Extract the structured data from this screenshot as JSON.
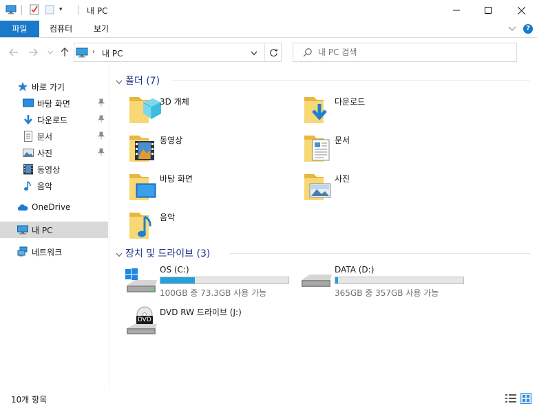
{
  "window": {
    "title": "내 PC",
    "quick_access_dropdown": "▾",
    "minimize_glyph": "—",
    "maximize_glyph": "☐",
    "close_glyph": "✕"
  },
  "ribbon": {
    "tabs": [
      {
        "label": "파일",
        "active": true
      },
      {
        "label": "컴퓨터"
      },
      {
        "label": "보기"
      }
    ],
    "help_glyph": "?"
  },
  "address_bar": {
    "path": "내 PC",
    "separator": "›"
  },
  "search": {
    "placeholder": "내 PC 검색"
  },
  "sidebar": {
    "quick_access": {
      "label": "바로 가기",
      "icon": "star-icon"
    },
    "pinned": [
      {
        "label": "바탕 화면",
        "icon": "desktop-icon",
        "pinned": true
      },
      {
        "label": "다운로드",
        "icon": "download-icon",
        "pinned": true
      },
      {
        "label": "문서",
        "icon": "document-icon",
        "pinned": true
      },
      {
        "label": "사진",
        "icon": "pictures-icon",
        "pinned": true
      },
      {
        "label": "동영상",
        "icon": "video-icon",
        "pinned": false
      },
      {
        "label": "음악",
        "icon": "music-icon",
        "pinned": false
      }
    ],
    "onedrive": {
      "label": "OneDrive",
      "icon": "cloud-icon"
    },
    "this_pc": {
      "label": "내 PC",
      "icon": "pc-icon",
      "selected": true
    },
    "network": {
      "label": "네트워크",
      "icon": "network-icon"
    }
  },
  "folders_group": {
    "label": "폴더 (7)",
    "items": [
      {
        "label": "3D 개체",
        "overlay": "3d-cube-icon"
      },
      {
        "label": "다운로드",
        "overlay": "download-arrow-icon"
      },
      {
        "label": "동영상",
        "overlay": "film-icon"
      },
      {
        "label": "문서",
        "overlay": "document-icon"
      },
      {
        "label": "바탕 화면",
        "overlay": "desktop-icon"
      },
      {
        "label": "사진",
        "overlay": "landscape-icon"
      },
      {
        "label": "음악",
        "overlay": "music-note-icon"
      }
    ]
  },
  "drives_group": {
    "label": "장치 및 드라이브 (3)",
    "items": [
      {
        "name": "OS (C:)",
        "status": "100GB 중 73.3GB 사용 가능",
        "used_fraction": 0.267,
        "icon": "windows-drive-icon",
        "has_bar": true
      },
      {
        "name": "DATA (D:)",
        "status": "365GB 중 357GB 사용 가능",
        "used_fraction": 0.022,
        "icon": "hard-drive-icon",
        "has_bar": true
      },
      {
        "name": "DVD RW 드라이브 (J:)",
        "status": "",
        "icon": "dvd-drive-icon",
        "has_bar": false,
        "disc_label": "DVD"
      }
    ]
  },
  "status_bar": {
    "item_count": "10개 항목"
  },
  "colors": {
    "accent": "#1979ca",
    "group_header": "#1e3287",
    "usage_bar": "#26a0da",
    "folder": "#f5c85a"
  }
}
